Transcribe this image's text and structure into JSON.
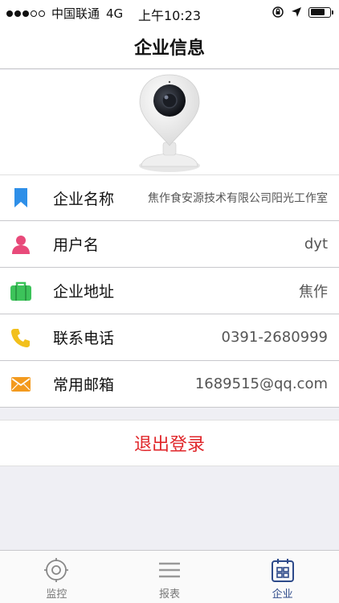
{
  "status_bar": {
    "carrier": "中国联通",
    "network": "4G",
    "time": "上午10:23"
  },
  "nav": {
    "title": "企业信息"
  },
  "info_rows": [
    {
      "icon": "bookmark-icon",
      "color": "#2e8fe8",
      "label": "企业名称",
      "value": "焦作食安源技术有限公司阳光工作室"
    },
    {
      "icon": "user-icon",
      "color": "#e84a7a",
      "label": "用户名",
      "value": "dyt"
    },
    {
      "icon": "briefcase-icon",
      "color": "#3cc35a",
      "label": "企业地址",
      "value": "焦作"
    },
    {
      "icon": "phone-icon",
      "color": "#f2c01c",
      "label": "联系电话",
      "value": "0391-2680999"
    },
    {
      "icon": "mail-icon",
      "color": "#f39a1e",
      "label": "常用邮箱",
      "value": "1689515@qq.com"
    }
  ],
  "logout": {
    "label": "退出登录",
    "color": "#e0262a"
  },
  "tabs": [
    {
      "icon": "monitor-icon",
      "label": "监控",
      "active": false
    },
    {
      "icon": "report-icon",
      "label": "报表",
      "active": false
    },
    {
      "icon": "company-icon",
      "label": "企业",
      "active": true
    }
  ]
}
